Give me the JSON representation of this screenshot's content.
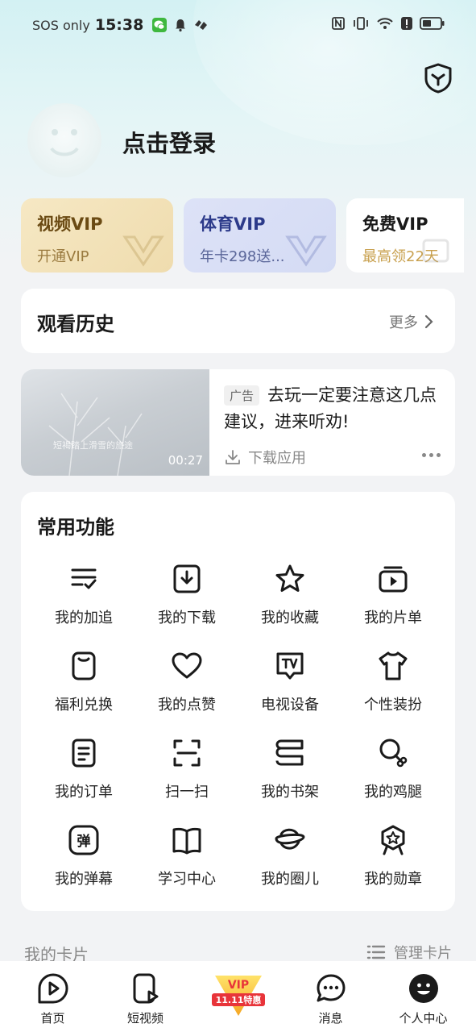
{
  "status_bar": {
    "carrier": "SOS only",
    "time": "15:38"
  },
  "profile": {
    "login_text": "点击登录"
  },
  "vip_cards": [
    {
      "title": "视频VIP",
      "subtitle": "开通VIP"
    },
    {
      "title": "体育VIP",
      "subtitle": "年卡298送..."
    },
    {
      "title": "免费VIP",
      "subtitle": "最高领22天"
    }
  ],
  "history": {
    "title": "观看历史",
    "more": "更多"
  },
  "ad": {
    "tag": "广告",
    "text": "去玩一定要注意这几点建议，进来听劝!",
    "thumb_caption": "短褐踏上滑雪的旅途",
    "duration": "00:27",
    "download": "下载应用"
  },
  "features": {
    "title": "常用功能",
    "items": [
      {
        "label": "我的加追",
        "icon": "follow-list-icon"
      },
      {
        "label": "我的下载",
        "icon": "download-icon"
      },
      {
        "label": "我的收藏",
        "icon": "star-icon"
      },
      {
        "label": "我的片单",
        "icon": "playlist-icon"
      },
      {
        "label": "福利兑换",
        "icon": "exchange-icon"
      },
      {
        "label": "我的点赞",
        "icon": "heart-icon"
      },
      {
        "label": "电视设备",
        "icon": "tv-icon"
      },
      {
        "label": "个性装扮",
        "icon": "tshirt-icon"
      },
      {
        "label": "我的订单",
        "icon": "order-icon"
      },
      {
        "label": "扫一扫",
        "icon": "scan-icon"
      },
      {
        "label": "我的书架",
        "icon": "bookshelf-icon"
      },
      {
        "label": "我的鸡腿",
        "icon": "drumstick-icon"
      },
      {
        "label": "我的弹幕",
        "icon": "danmaku-icon"
      },
      {
        "label": "学习中心",
        "icon": "book-icon"
      },
      {
        "label": "我的圈儿",
        "icon": "planet-icon"
      },
      {
        "label": "我的勋章",
        "icon": "medal-icon"
      }
    ]
  },
  "cards_section": {
    "title": "我的卡片",
    "manage": "管理卡片"
  },
  "tabbar": {
    "items": [
      {
        "label": "首页",
        "icon": "home-play-icon"
      },
      {
        "label": "短视频",
        "icon": "short-video-icon"
      },
      {
        "label": "",
        "icon": "vip-1111-badge",
        "badge_lines": [
          "VIP",
          "11.11特惠"
        ]
      },
      {
        "label": "消息",
        "icon": "message-icon"
      },
      {
        "label": "个人中心",
        "icon": "profile-icon"
      }
    ]
  }
}
